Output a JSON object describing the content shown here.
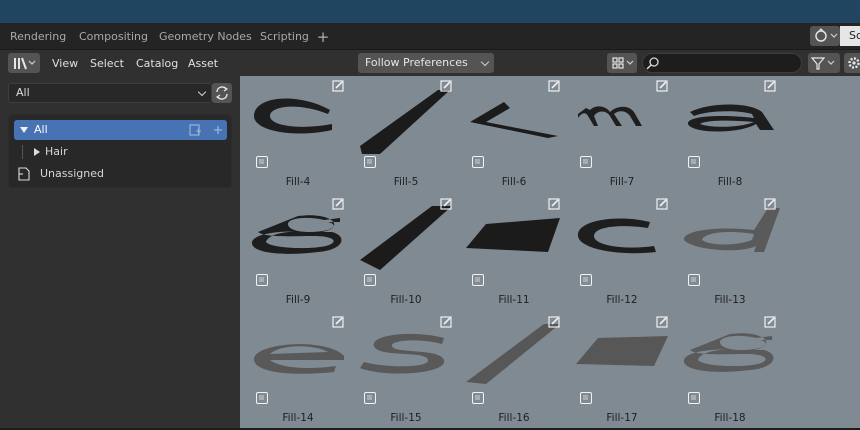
{
  "workspace_tabs": [
    "Rendering",
    "Compositing",
    "Geometry Nodes",
    "Scripting"
  ],
  "scene_field": "Sc",
  "header": {
    "menus": [
      "View",
      "Select",
      "Catalog",
      "Asset"
    ],
    "import_method": "Follow Preferences",
    "search_placeholder": ""
  },
  "sidebar": {
    "library": "All",
    "catalogs": [
      {
        "label": "All",
        "active": true
      },
      {
        "label": "Hair",
        "active": false
      },
      {
        "label": "Unassigned",
        "active": false
      }
    ]
  },
  "assets": [
    {
      "label": "Fill-4",
      "glyph": "c-flat"
    },
    {
      "label": "Fill-5",
      "glyph": "slash-dark"
    },
    {
      "label": "Fill-6",
      "glyph": "less-than"
    },
    {
      "label": "Fill-7",
      "glyph": "m"
    },
    {
      "label": "Fill-8",
      "glyph": "a"
    },
    {
      "label": "Fill-9",
      "glyph": "g"
    },
    {
      "label": "Fill-10",
      "glyph": "bar-dark"
    },
    {
      "label": "Fill-11",
      "glyph": "quad-dark"
    },
    {
      "label": "Fill-12",
      "glyph": "c-dark"
    },
    {
      "label": "Fill-13",
      "glyph": "d-grey"
    },
    {
      "label": "Fill-14",
      "glyph": "e-grey"
    },
    {
      "label": "Fill-15",
      "glyph": "s-grey"
    },
    {
      "label": "Fill-16",
      "glyph": "bar-grey"
    },
    {
      "label": "Fill-17",
      "glyph": "quad-grey"
    },
    {
      "label": "Fill-18",
      "glyph": "g-grey"
    }
  ],
  "colors": {
    "topbar": "#1f4561",
    "active_catalog": "#4772b3",
    "browser_bg": "#808a93"
  }
}
